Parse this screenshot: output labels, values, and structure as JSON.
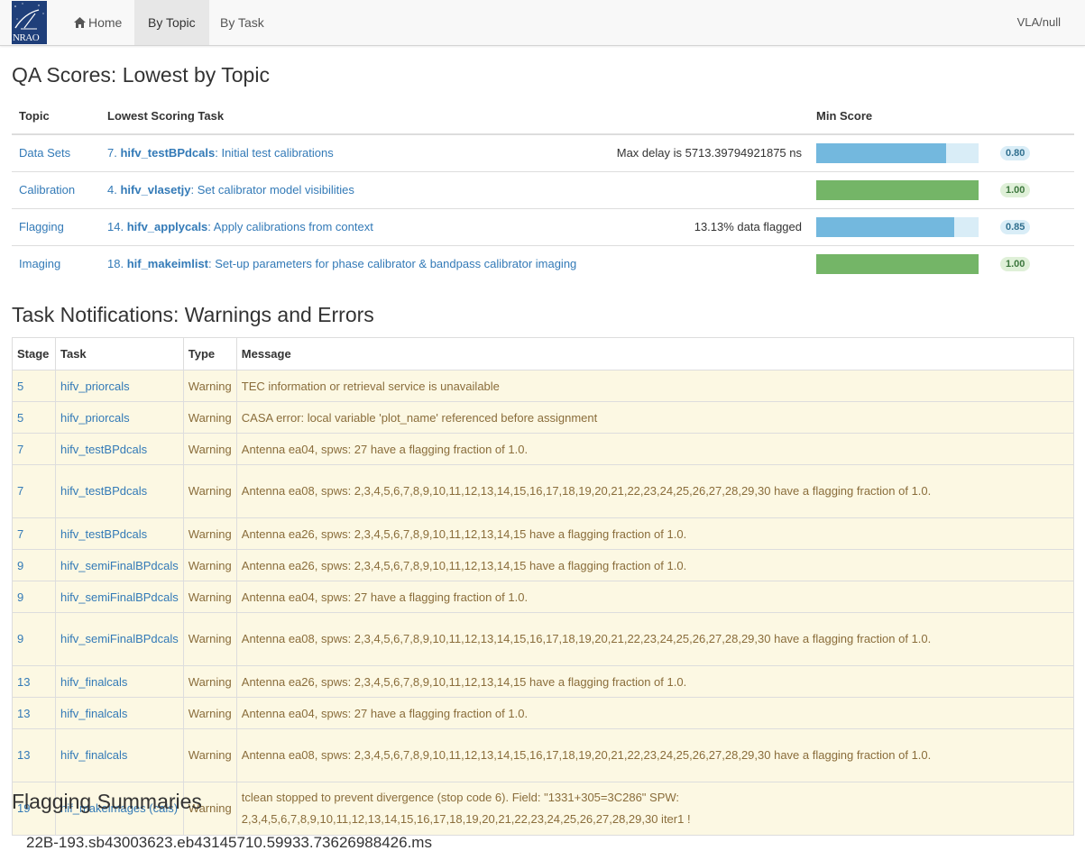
{
  "nav": {
    "brand_text": "NRAO",
    "home": "Home",
    "by_topic": "By Topic",
    "by_task": "By Task",
    "right": "VLA/null"
  },
  "qa": {
    "title": "QA Scores: Lowest by Topic",
    "headers": {
      "topic": "Topic",
      "task": "Lowest Scoring Task",
      "score": "Min Score"
    },
    "rows": [
      {
        "topic": "Data Sets",
        "num": "7. ",
        "task": "hifv_testBPdcals",
        "desc": ": Initial test calibrations",
        "note": "Max delay is 5713.39794921875 ns",
        "score": 0.8,
        "score_label": "0.80",
        "status": "info"
      },
      {
        "topic": "Calibration",
        "num": "4. ",
        "task": "hifv_vlasetjy",
        "desc": ": Set calibrator model visibilities",
        "note": "",
        "score": 1.0,
        "score_label": "1.00",
        "status": "success"
      },
      {
        "topic": "Flagging",
        "num": "14. ",
        "task": "hifv_applycals",
        "desc": ": Apply calibrations from context",
        "note": "13.13% data flagged",
        "score": 0.85,
        "score_label": "0.85",
        "status": "info"
      },
      {
        "topic": "Imaging",
        "num": "18. ",
        "task": "hif_makeimlist",
        "desc": ": Set-up parameters for phase calibrator & bandpass calibrator imaging",
        "note": "",
        "score": 1.0,
        "score_label": "1.00",
        "status": "success"
      }
    ]
  },
  "notifications": {
    "title": "Task Notifications: Warnings and Errors",
    "headers": {
      "stage": "Stage",
      "task": "Task",
      "type": "Type",
      "message": "Message"
    },
    "rows": [
      {
        "stage": "5",
        "task": "hifv_priorcals",
        "type": "Warning",
        "message": "TEC information or retrieval service is unavailable"
      },
      {
        "stage": "5",
        "task": "hifv_priorcals",
        "type": "Warning",
        "message": "CASA error: local variable 'plot_name' referenced before assignment"
      },
      {
        "stage": "7",
        "task": "hifv_testBPdcals",
        "type": "Warning",
        "message": "Antenna ea04, spws: 27 have a flagging fraction of 1.0."
      },
      {
        "stage": "7",
        "task": "hifv_testBPdcals",
        "type": "Warning",
        "message": "Antenna ea08, spws: 2,3,4,5,6,7,8,9,10,11,12,13,14,15,16,17,18,19,20,21,22,23,24,25,26,27,28,29,30 have a flagging fraction of 1.0."
      },
      {
        "stage": "7",
        "task": "hifv_testBPdcals",
        "type": "Warning",
        "message": "Antenna ea26, spws: 2,3,4,5,6,7,8,9,10,11,12,13,14,15 have a flagging fraction of 1.0."
      },
      {
        "stage": "9",
        "task": "hifv_semiFinalBPdcals",
        "type": "Warning",
        "message": "Antenna ea26, spws: 2,3,4,5,6,7,8,9,10,11,12,13,14,15 have a flagging fraction of 1.0."
      },
      {
        "stage": "9",
        "task": "hifv_semiFinalBPdcals",
        "type": "Warning",
        "message": "Antenna ea04, spws: 27 have a flagging fraction of 1.0."
      },
      {
        "stage": "9",
        "task": "hifv_semiFinalBPdcals",
        "type": "Warning",
        "message": "Antenna ea08, spws: 2,3,4,5,6,7,8,9,10,11,12,13,14,15,16,17,18,19,20,21,22,23,24,25,26,27,28,29,30 have a flagging fraction of 1.0."
      },
      {
        "stage": "13",
        "task": "hifv_finalcals",
        "type": "Warning",
        "message": "Antenna ea26, spws: 2,3,4,5,6,7,8,9,10,11,12,13,14,15 have a flagging fraction of 1.0."
      },
      {
        "stage": "13",
        "task": "hifv_finalcals",
        "type": "Warning",
        "message": "Antenna ea04, spws: 27 have a flagging fraction of 1.0."
      },
      {
        "stage": "13",
        "task": "hifv_finalcals",
        "type": "Warning",
        "message": "Antenna ea08, spws: 2,3,4,5,6,7,8,9,10,11,12,13,14,15,16,17,18,19,20,21,22,23,24,25,26,27,28,29,30 have a flagging fraction of 1.0."
      },
      {
        "stage": "19",
        "task": "hif_makeimages (cals)",
        "type": "Warning",
        "message": "tclean stopped to prevent divergence (stop code 6). Field: \"1331+305=3C286\" SPW: 2,3,4,5,6,7,8,9,10,11,12,13,14,15,16,17,18,19,20,21,22,23,24,25,26,27,28,29,30 iter1 !"
      }
    ]
  },
  "flagging": {
    "title": "Flagging Summaries",
    "ms_name": "22B-193.sb43003623.eb43145710.59933.73626988426.ms"
  },
  "colors": {
    "info_bar": "#73b8de",
    "success_bar": "#74b567",
    "warning_row": "#fcf8e3",
    "link": "#337ab7"
  }
}
